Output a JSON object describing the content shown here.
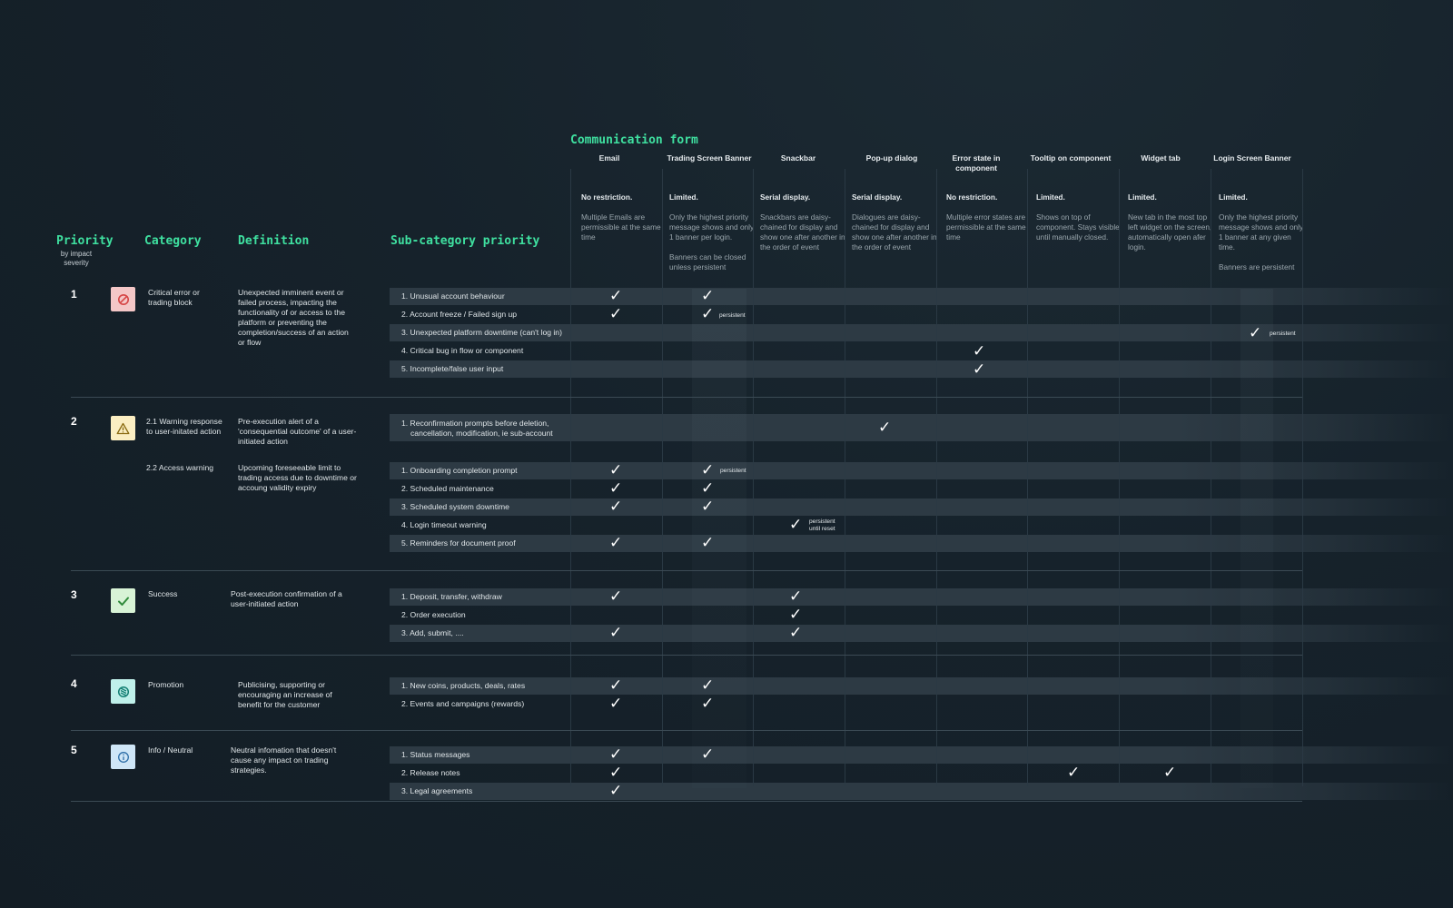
{
  "headers": {
    "communication_form": "Communication form",
    "priority": "Priority",
    "priority_sub": "by impact severity",
    "category": "Category",
    "definition": "Definition",
    "subcategory": "Sub-category priority"
  },
  "columns": [
    {
      "name": "Email",
      "rule": "No restriction.",
      "desc": "Multiple Emails are permissible at the same time"
    },
    {
      "name": "Trading Screen Banner",
      "rule": "Limited.",
      "desc": "Only the highest priority message shows and only 1 banner per login.",
      "desc2": "Banners can be closed unless persistent"
    },
    {
      "name": "Snackbar",
      "rule": "Serial display.",
      "desc": "Snackbars are daisy-chained for display and show one after another in the order of event"
    },
    {
      "name": "Pop-up dialog",
      "rule": "Serial display.",
      "desc": "Dialogues are daisy-chained for display and show one after another in the order of event"
    },
    {
      "name": "Error state in component",
      "rule": "No restriction.",
      "desc": "Multiple error states are permissible at the same time"
    },
    {
      "name": "Tooltip on component",
      "rule": "Limited.",
      "desc": "Shows on top of component. Stays visible until manually closed."
    },
    {
      "name": "Widget tab",
      "rule": "Limited.",
      "desc": "New tab in the most top left widget on the screen, automatically open afer login."
    },
    {
      "name": "Login Screen Banner",
      "rule": "Limited.",
      "desc": "Only the highest priority message shows and only 1 banner at any given time.",
      "desc2": "Banners are persistent"
    }
  ],
  "groups": [
    {
      "priority": "1",
      "category": "Critical error or trading block",
      "definition": "Unexpected imminent event or failed process, impacting the functionality of or access to the platform or preventing the completion/success of an action or flow",
      "icon": "block-icon",
      "icon_bg": "#f4c7c7",
      "icon_color": "#d64545"
    },
    {
      "priority": "2",
      "category": "2.1 Warning response to user-initated action",
      "category2": "2.2 Access warning",
      "definition": "Pre-execution alert of a 'consequential outcome' of a user-initiated action",
      "definition2": "Upcoming foreseeable limit to trading access due to downtime or accoung validity expiry",
      "icon": "warning-icon",
      "icon_bg": "#fbeec2",
      "icon_color": "#8a6a10"
    },
    {
      "priority": "3",
      "category": "Success",
      "definition": "Post-execution confirmation of a user-initiated action",
      "icon": "check-icon",
      "icon_bg": "#d8f3d6",
      "icon_color": "#2f8a3a"
    },
    {
      "priority": "4",
      "category": "Promotion",
      "definition": "Publicising, supporting or encouraging an increase of benefit for the customer",
      "icon": "promotion-icon",
      "icon_bg": "#bff0ea",
      "icon_color": "#137f73"
    },
    {
      "priority": "5",
      "category": "Info / Neutral",
      "definition": "Neutral infomation that doesn't cause any impact on trading strategies.",
      "icon": "info-icon",
      "icon_bg": "#cfe6f7",
      "icon_color": "#2d6ea8"
    }
  ],
  "rows": [
    {
      "label": "1. Unusual account behaviour"
    },
    {
      "label": "2. Account freeze / Failed sign up",
      "note": "persistent"
    },
    {
      "label": "3. Unexpected platform downtime (can't log in)",
      "note": "persistent"
    },
    {
      "label": "4. Critical bug in flow or component"
    },
    {
      "label": "5. Incomplete/false user input"
    },
    {
      "label": "1. Reconfirmation prompts before deletion, cancellation, modification, ie sub-account"
    },
    {
      "label": "1. Onboarding completion prompt",
      "note": "persistent"
    },
    {
      "label": "2. Scheduled maintenance"
    },
    {
      "label": "3. Scheduled system downtime"
    },
    {
      "label": "4. Login timeout warning",
      "note": "persistent until reset"
    },
    {
      "label": "5. Reminders for document proof"
    },
    {
      "label": "1. Deposit, transfer, withdraw"
    },
    {
      "label": "2. Order execution"
    },
    {
      "label": "3. Add, submit, ...."
    },
    {
      "label": "1. New coins, products, deals, rates"
    },
    {
      "label": "2. Events and campaigns (rewards)"
    },
    {
      "label": "1. Status messages"
    },
    {
      "label": "2. Release notes"
    },
    {
      "label": "3. Legal agreements"
    }
  ],
  "check_glyph": "✓"
}
